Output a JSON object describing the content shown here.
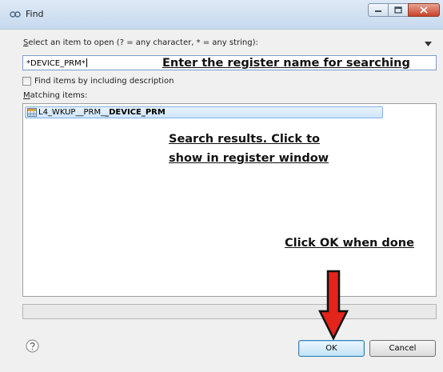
{
  "window": {
    "title": "Find",
    "colors": {
      "titlebar": "#d0e0f1",
      "close": "#c7432a",
      "accent_arrow": "#e3241b"
    }
  },
  "select_label_prefix": "S",
  "select_label_rest": "elect an item to open (? = any character, * = any string):",
  "search": {
    "value": "*DEVICE_PRM*"
  },
  "checkbox": {
    "label": "Find items by including description",
    "checked": false
  },
  "matching_label_prefix": "M",
  "matching_label_rest": "atching items:",
  "results": [
    {
      "prefix": "L4_WKUP__PRM_",
      "bold": "_DEVICE_PRM",
      "icon": "register-table-icon"
    }
  ],
  "annotations": {
    "enter": "Enter the register name for searching",
    "results_line1": "Search results. Click to",
    "results_line2": "show in register window",
    "ok": "Click OK when done"
  },
  "buttons": {
    "ok": "OK",
    "cancel": "Cancel"
  },
  "icons": {
    "title": "find-icon",
    "menu": "chevron-down-icon",
    "help": "help-icon",
    "arrow": "red-down-arrow-icon"
  }
}
